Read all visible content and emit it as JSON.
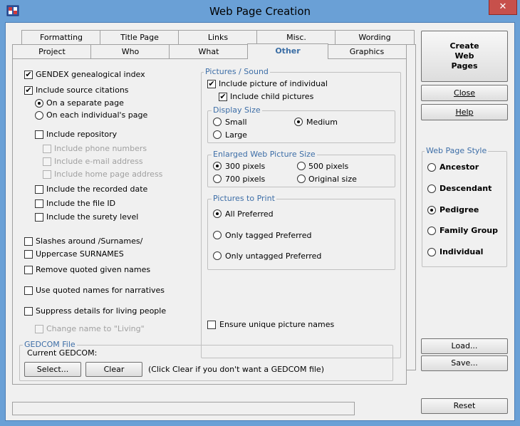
{
  "window": {
    "title": "Web Page Creation",
    "close_glyph": "✕",
    "icon": "app-shield-icon",
    "accent": "#6aa0d6"
  },
  "tabs_back": [
    "Formatting",
    "Title Page",
    "Links",
    "Misc.",
    "Wording"
  ],
  "tabs_front": [
    "Project",
    "Who",
    "What",
    "Other",
    "Graphics"
  ],
  "active_tab": "Other",
  "left_options": {
    "gendex": {
      "label": "GENDEX genealogical index",
      "checked": true
    },
    "source_citations": {
      "label": "Include source citations",
      "checked": true
    },
    "on_separate_page": {
      "label": "On a separate page",
      "selected": true
    },
    "on_each_page": {
      "label": "On each individual's page",
      "selected": false
    },
    "include_repository": {
      "label": "Include repository",
      "checked": false
    },
    "phone_numbers": {
      "label": "Include phone numbers",
      "checked": false
    },
    "email_address": {
      "label": "Include e-mail address",
      "checked": false
    },
    "home_page": {
      "label": "Include home page address",
      "checked": false
    },
    "recorded_date": {
      "label": "Include the recorded date",
      "checked": false
    },
    "file_id": {
      "label": "Include the file ID",
      "checked": false
    },
    "surety_level": {
      "label": "Include the surety level",
      "checked": false
    },
    "slashes_surnames": {
      "label": "Slashes around /Surnames/",
      "checked": false
    },
    "uppercase_surnames": {
      "label": "Uppercase SURNAMES",
      "checked": false
    },
    "remove_quoted": {
      "label": "Remove quoted given names",
      "checked": false
    },
    "quoted_narratives": {
      "label": "Use quoted names for narratives",
      "checked": false
    },
    "suppress_living": {
      "label": "Suppress details for living people",
      "checked": false
    },
    "change_living": {
      "label": "Change name to \"Living\"",
      "checked": false
    }
  },
  "pictures": {
    "title": "Pictures / Sound",
    "include_picture": {
      "label": "Include picture of individual",
      "checked": true
    },
    "include_child": {
      "label": "Include child pictures",
      "checked": true
    },
    "display_size": {
      "title": "Display Size",
      "small": "Small",
      "medium": "Medium",
      "large": "Large",
      "selected": "Medium"
    },
    "enlarged_size": {
      "title": "Enlarged Web Picture Size",
      "p300": "300 pixels",
      "p500": "500 pixels",
      "p700": "700 pixels",
      "original": "Original size",
      "selected": "300 pixels"
    },
    "to_print": {
      "title": "Pictures to Print",
      "all": "All Preferred",
      "tagged": "Only tagged Preferred",
      "untagged": "Only untagged Preferred",
      "selected": "All Preferred"
    },
    "unique_names": {
      "label": "Ensure unique picture names",
      "checked": false
    }
  },
  "gedcom": {
    "title": "GEDCOM File",
    "current_label": "Current GEDCOM:",
    "select_label": "Select...",
    "clear_label": "Clear",
    "hint": "(Click Clear if you don't want a GEDCOM file)"
  },
  "right_buttons": {
    "create_line1": "Create",
    "create_line2": "Web",
    "create_line3": "Pages",
    "close": "Close",
    "help": "Help",
    "load": "Load...",
    "save": "Save...",
    "reset": "Reset"
  },
  "style_group": {
    "title": "Web Page Style",
    "ancestor": "Ancestor",
    "descendant": "Descendant",
    "pedigree": "Pedigree",
    "family_group": "Family Group",
    "individual": "Individual",
    "selected": "Pedigree"
  },
  "check_glyph": "✔"
}
